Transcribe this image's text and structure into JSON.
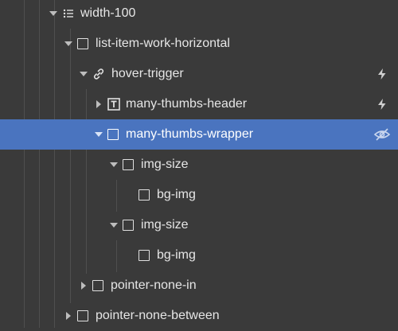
{
  "navigator": {
    "items": [
      {
        "label": "width-100",
        "icon": "list-icon",
        "expanded": true
      },
      {
        "label": "list-item-work-horizontal",
        "icon": "div-block-icon",
        "expanded": true
      },
      {
        "label": "hover-trigger",
        "icon": "link-icon",
        "expanded": true,
        "badge": "interaction-bolt-icon"
      },
      {
        "label": "many-thumbs-header",
        "icon": "text-block-icon",
        "expanded": false,
        "badge": "interaction-bolt-icon"
      },
      {
        "label": "many-thumbs-wrapper",
        "icon": "div-block-icon",
        "expanded": true,
        "selected": true,
        "badge": "hidden-eye-icon"
      },
      {
        "label": "img-size",
        "icon": "div-block-icon",
        "expanded": true
      },
      {
        "label": "bg-img",
        "icon": "div-block-icon"
      },
      {
        "label": "img-size",
        "icon": "div-block-icon",
        "expanded": true
      },
      {
        "label": "bg-img",
        "icon": "div-block-icon"
      },
      {
        "label": "pointer-none-in",
        "icon": "div-block-icon",
        "expanded": false
      },
      {
        "label": "pointer-none-between",
        "icon": "div-block-icon",
        "expanded": false
      }
    ]
  },
  "colors": {
    "background": "#3a3a3a",
    "selected_row": "#4a74bf",
    "text": "#e6e6e6",
    "guide_line": "#4f4f4f"
  }
}
